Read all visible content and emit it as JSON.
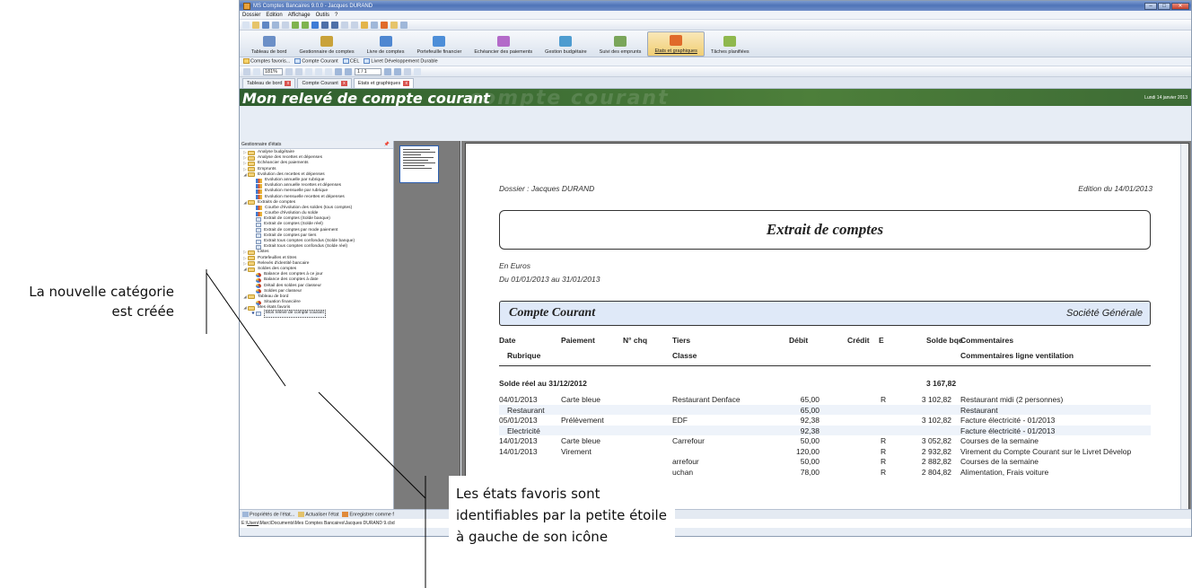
{
  "window": {
    "title": "MS Comptes Bancaires 9.0.0 - Jacques DURAND",
    "btn_min": "–",
    "btn_max": "□",
    "btn_close": "✕"
  },
  "menu": [
    "Dossier",
    "Edition",
    "Affichage",
    "Outils",
    "?"
  ],
  "toolbar_icons": [
    "new-icon",
    "open-icon",
    "save-icon",
    "print-icon",
    "preview-icon",
    "undo-icon",
    "redo-icon",
    "help-icon",
    "back-icon",
    "forward-icon",
    "home-icon",
    "refresh-icon",
    "favorite-icon",
    "calendar-icon",
    "report-icon",
    "folder-icon",
    "settings-icon"
  ],
  "ribbon": [
    {
      "label": "Tableau de bord",
      "icon": "dashboard-icon",
      "color": "#6b8fc7"
    },
    {
      "label": "Gestionnaire de comptes",
      "icon": "vault-icon",
      "color": "#c9a23a"
    },
    {
      "label": "Livre de comptes",
      "icon": "book-icon",
      "color": "#4f87d1"
    },
    {
      "label": "Portefeuille financier",
      "icon": "building-icon",
      "color": "#4d8ed8"
    },
    {
      "label": "Echéancier des paiements",
      "icon": "percent-icon",
      "color": "#b36ac9"
    },
    {
      "label": "Gestion budgétaire",
      "icon": "budget-icon",
      "color": "#4e9cd0"
    },
    {
      "label": "Suivi des emprunts",
      "icon": "house-icon",
      "color": "#7aa55a"
    },
    {
      "label": "Etats et graphiques",
      "icon": "pie-chart-icon",
      "color": "#e06a2a"
    },
    {
      "label": "Tâches planifiées",
      "icon": "checklist-icon",
      "color": "#8fb84e"
    }
  ],
  "favbar": [
    "Comptes favoris...",
    "Compte Courant",
    "CEL",
    "Livret Développement Durable"
  ],
  "toolbar2": {
    "zoom": "181%",
    "page": "1 / 1"
  },
  "tabs": [
    "Tableau de bord",
    "Compte Courant",
    "Etats et graphiques"
  ],
  "banner": {
    "title": "Mon relevé de compte courant",
    "ghost": "compte courant",
    "date": "Lundi 14 janvier 2013"
  },
  "left_pane": {
    "title": "Gestionnaire d'états",
    "pin": "📌"
  },
  "tree": [
    {
      "label": "Analyse budgétaire",
      "type": "folder",
      "depth": 0,
      "toggle": "▷"
    },
    {
      "label": "Analyse des recettes et dépenses",
      "type": "folder",
      "depth": 0,
      "toggle": "▷"
    },
    {
      "label": "Echéancier des paiements",
      "type": "folder",
      "depth": 0,
      "toggle": "▷"
    },
    {
      "label": "Emprunts",
      "type": "folder",
      "depth": 0,
      "toggle": "▷"
    },
    {
      "label": "Evolution des recettes et dépenses",
      "type": "folder",
      "depth": 0,
      "toggle": "◢"
    },
    {
      "label": "Evolution annuelle par rubrique",
      "type": "rpt",
      "depth": 1,
      "toggle": ""
    },
    {
      "label": "Evolution annuelle recettes et dépenses",
      "type": "rpt",
      "depth": 1,
      "toggle": ""
    },
    {
      "label": "Evolution mensuelle par rubrique",
      "type": "rpt",
      "depth": 1,
      "toggle": ""
    },
    {
      "label": "Evolution mensuelle recettes et dépenses",
      "type": "rpt",
      "depth": 1,
      "toggle": ""
    },
    {
      "label": "Extraits de comptes",
      "type": "folder",
      "depth": 0,
      "toggle": "◢"
    },
    {
      "label": "Courbe d'évolution des soldes (tous comptes)",
      "type": "rpt",
      "depth": 1,
      "toggle": ""
    },
    {
      "label": "Courbe d'évolution du solde",
      "type": "rpt",
      "depth": 1,
      "toggle": ""
    },
    {
      "label": "Extrait de comptes (Solde banque)",
      "type": "doc",
      "depth": 1,
      "toggle": ""
    },
    {
      "label": "Extrait de comptes (Solde réel)",
      "type": "doc",
      "depth": 1,
      "toggle": ""
    },
    {
      "label": "Extrait de comptes par mode paiement",
      "type": "doc",
      "depth": 1,
      "toggle": ""
    },
    {
      "label": "Extrait de comptes par tiers",
      "type": "doc",
      "depth": 1,
      "toggle": ""
    },
    {
      "label": "Extrait tous comptes confondus (Solde banque)",
      "type": "doc",
      "depth": 1,
      "toggle": ""
    },
    {
      "label": "Extrait tous comptes confondus (Solde réel)",
      "type": "doc",
      "depth": 1,
      "toggle": ""
    },
    {
      "label": "Listes",
      "type": "folder",
      "depth": 0,
      "toggle": "▷"
    },
    {
      "label": "Portefeuilles et titres",
      "type": "folder",
      "depth": 0,
      "toggle": "▷"
    },
    {
      "label": "Relevés d'identité bancaire",
      "type": "folder",
      "depth": 0,
      "toggle": "▷"
    },
    {
      "label": "Soldes des comptes",
      "type": "folder",
      "depth": 0,
      "toggle": "◢"
    },
    {
      "label": "Balance des comptes à ce jour",
      "type": "pie",
      "depth": 1,
      "toggle": ""
    },
    {
      "label": "Balance des comptes à date",
      "type": "pie",
      "depth": 1,
      "toggle": ""
    },
    {
      "label": "Détail des soldes par classeur",
      "type": "pie",
      "depth": 1,
      "toggle": ""
    },
    {
      "label": "Soldes par classeur",
      "type": "pie",
      "depth": 1,
      "toggle": ""
    },
    {
      "label": "Tableau de bord",
      "type": "folder",
      "depth": 0,
      "toggle": "◢"
    },
    {
      "label": "Situation financière",
      "type": "pie",
      "depth": 1,
      "toggle": ""
    },
    {
      "label": "Mes états favoris",
      "type": "folder",
      "depth": 0,
      "toggle": "◢"
    },
    {
      "label": "Mon relevé de compte courant",
      "type": "doc",
      "depth": 1,
      "toggle": "★",
      "selected": true
    }
  ],
  "report": {
    "dossier": "Dossier : Jacques DURAND",
    "edition": "Edition du 14/01/2013",
    "title": "Extrait de comptes",
    "currency": "En Euros",
    "period": "Du 01/01/2013 au 31/01/2013",
    "account": "Compte Courant",
    "bank": "Société Générale",
    "headers": {
      "date": "Date",
      "rubrique": "Rubrique",
      "paiement": "Paiement",
      "nchq": "N° chq",
      "tiers": "Tiers",
      "classe": "Classe",
      "debit": "Débit",
      "credit": "Crédit",
      "e": "E",
      "solde": "Solde bqe",
      "comm": "Commentaires",
      "comm2": "Commentaires ligne ventilation"
    },
    "opening": {
      "label": "Solde réel au 31/12/2012",
      "value": "3 167,82"
    },
    "rows": [
      {
        "date": "04/01/2013",
        "pay": "Carte bleue",
        "tiers": "Restaurant Denface",
        "debit": "65,00",
        "e": "R",
        "solde": "3 102,82",
        "comm": "Restaurant midi (2 personnes)"
      },
      {
        "sub": "Restaurant",
        "debit": "65,00",
        "comm": "Restaurant"
      },
      {
        "date": "05/01/2013",
        "pay": "Prélèvement",
        "tiers": "EDF",
        "debit": "92,38",
        "e": "",
        "solde": "3 102,82",
        "comm": "Facture électricité - 01/2013"
      },
      {
        "sub": "Electricité",
        "debit": "92,38",
        "comm": "Facture électricité - 01/2013"
      },
      {
        "date": "14/01/2013",
        "pay": "Carte bleue",
        "tiers": "Carrefour",
        "debit": "50,00",
        "e": "R",
        "solde": "3 052,82",
        "comm": "Courses de la semaine"
      },
      {
        "date": "14/01/2013",
        "pay": "Virement",
        "tiers": "",
        "debit": "120,00",
        "e": "R",
        "solde": "2 932,82",
        "comm": "Virement du Compte Courant sur le Livret Dévelop"
      },
      {
        "date": "",
        "pay": "",
        "tiers": "arrefour",
        "debit": "50,00",
        "e": "R",
        "solde": "2 882,82",
        "comm": "Courses de la semaine"
      },
      {
        "date": "",
        "pay": "",
        "tiers": "uchan",
        "debit": "78,00",
        "e": "R",
        "solde": "2 804,82",
        "comm": "Alimentation, Frais voiture"
      }
    ]
  },
  "status": [
    "Propriétés de l'état...",
    "Actualiser l'état",
    "Enregistrer comme f"
  ],
  "path": {
    "prefix": "E:\\",
    "users": "Users",
    "rest": "\\Marc\\Documents\\Mes Comptes Bancaires\\Jacques DURAND 9.cbd"
  },
  "annotations": {
    "left": "La nouvelle catégorie est créée",
    "box": "Les états favoris sont identifiables par la petite étoile à gauche de son icône"
  }
}
